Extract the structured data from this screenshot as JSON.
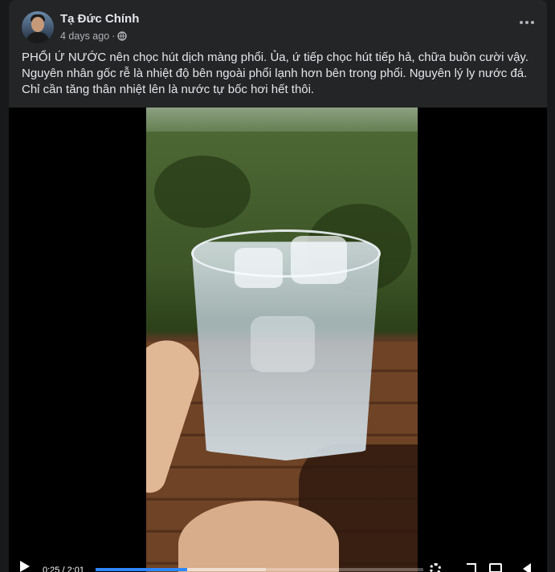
{
  "post": {
    "author": "Tạ Đức Chính",
    "timestamp": "4 days ago",
    "separator": "·",
    "privacy_icon": "globe-icon",
    "more_icon": "more-horizontal-icon",
    "text_lines": [
      "PHỔI Ứ NƯỚC nên chọc hút dịch màng phổi. Ủa, ứ tiếp chọc hút tiếp hả, chữa buồn cười vậy.",
      "Nguyên nhân gốc rễ là nhiệt độ bên ngoài phổi lạnh hơn bên trong phổi. Nguyên lý ly nước đá.",
      "Chỉ cần tăng thân nhiệt lên là nước tự bốc hơi hết thôi."
    ]
  },
  "video": {
    "time": "0:25 / 2:01",
    "progress_fraction": 0.28,
    "buffered_fraction": 0.52,
    "icons": [
      "play-icon",
      "settings-icon",
      "expand-icon",
      "picture-in-picture-icon",
      "volume-icon"
    ]
  },
  "colors": {
    "background": "#18191a",
    "card": "#242526",
    "text": "#e4e6eb",
    "secondary": "#b0b3b8",
    "accent": "#2d88ff"
  }
}
